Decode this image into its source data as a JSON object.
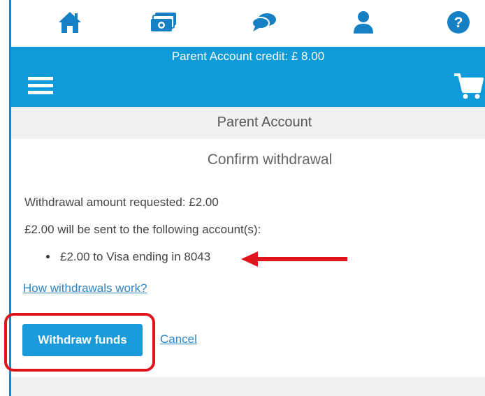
{
  "top_nav": {
    "icons": [
      "home-icon",
      "money-icon",
      "chat-icon",
      "user-icon",
      "help-icon"
    ]
  },
  "header": {
    "credit_text": "Parent Account credit: £ 8.00",
    "menu_icon": "hamburger-icon",
    "cart_icon": "cart-icon",
    "accent_color": "#0f9ad9"
  },
  "page": {
    "section_title": "Parent Account",
    "confirm_title": "Confirm withdrawal",
    "amount_line": "Withdrawal amount requested: £2.00",
    "sent_line": "£2.00 will be sent to the following account(s):",
    "accounts": [
      "£2.00 to Visa ending in 8043"
    ],
    "help_link": "How withdrawals work?",
    "withdraw_button": "Withdraw funds",
    "cancel_link": "Cancel"
  },
  "annotations": {
    "arrow_color": "#e0141c",
    "box_color": "#e0141c"
  }
}
